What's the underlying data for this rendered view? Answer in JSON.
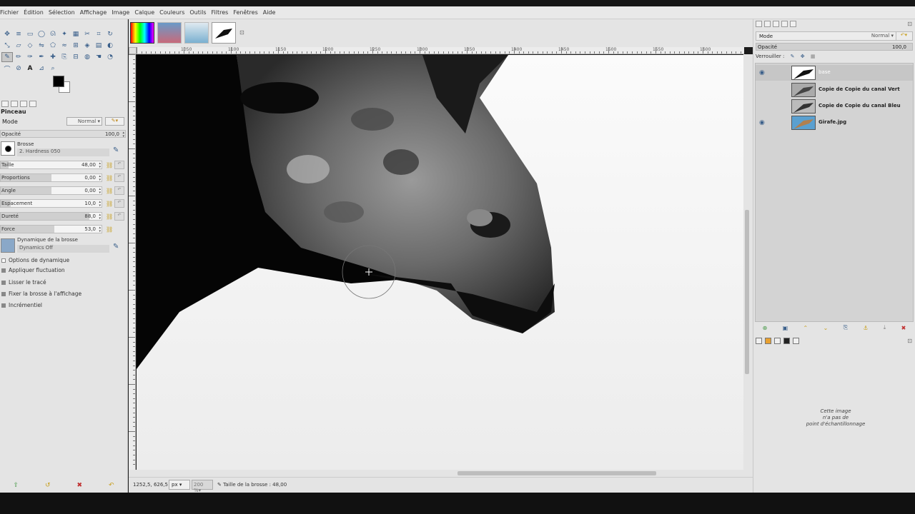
{
  "menu": [
    "Fichier",
    "Édition",
    "Sélection",
    "Affichage",
    "Image",
    "Calque",
    "Couleurs",
    "Outils",
    "Filtres",
    "Fenêtres",
    "Aide"
  ],
  "tool_options": {
    "title": "Pinceau",
    "mode_label": "Mode",
    "mode_value": "Normal",
    "opacity_label": "Opacité",
    "opacity_value": "100,0",
    "brush_label": "Brosse",
    "brush_name": "2. Hardness 050",
    "sliders": [
      {
        "label": "Taille",
        "value": "48,00",
        "fill": 0.08
      },
      {
        "label": "Proportions",
        "value": "0,00",
        "fill": 0.5
      },
      {
        "label": "Angle",
        "value": "0,00",
        "fill": 0.5
      },
      {
        "label": "Espacement",
        "value": "10,0",
        "fill": 0.1
      },
      {
        "label": "Dureté",
        "value": "88,0",
        "fill": 0.88
      },
      {
        "label": "Force",
        "value": "53,0",
        "fill": 0.53
      }
    ],
    "dynamics_label": "Dynamique de la brosse",
    "dynamics_name": "Dynamics Off",
    "dynamics_options": "Options de dynamique",
    "checks": [
      "Appliquer fluctuation",
      "Lisser le tracé",
      "Fixer la brosse à l'affichage",
      "Incrémentiel"
    ]
  },
  "ruler_labels": [
    "1050",
    "1100",
    "1150",
    "1200",
    "1250",
    "1300",
    "1350",
    "1400",
    "1450",
    "1500",
    "1550",
    "1600",
    "1650"
  ],
  "status": {
    "coords": "1252,5, 626,5",
    "unit": "px",
    "zoom": "200 %",
    "message": "Taille de la brosse : 48,00"
  },
  "layers_panel": {
    "mode_label": "Mode",
    "mode_value": "Normal",
    "opacity_label": "Opacité",
    "opacity_value": "100,0",
    "lock_label": "Verrouiller :",
    "layers": [
      {
        "name": "base",
        "visible": true,
        "selected": true
      },
      {
        "name": "Copie de Copie du canal Vert",
        "visible": false,
        "selected": false
      },
      {
        "name": "Copie de Copie du canal Bleu",
        "visible": false,
        "selected": false
      },
      {
        "name": "Girafe.jpg",
        "visible": true,
        "selected": false
      }
    ]
  },
  "sample_points": {
    "line1": "Cette image",
    "line2": "n'a pas de",
    "line3": "point d'échantillonnage"
  }
}
